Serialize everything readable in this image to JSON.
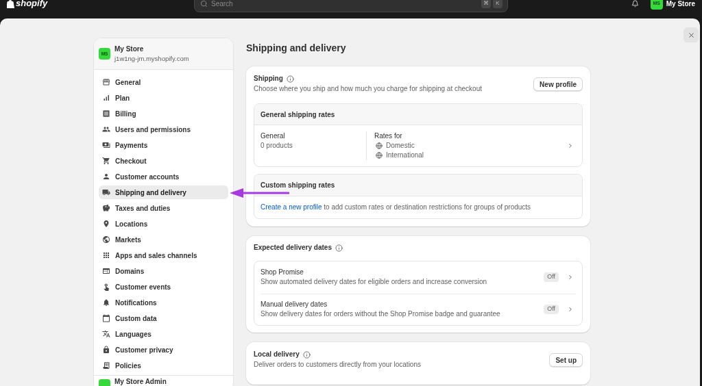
{
  "topbar": {
    "logo": "shopify",
    "search": {
      "placeholder": "Search",
      "shortcut": [
        "⌘",
        "K"
      ]
    },
    "account": {
      "initials": "MS",
      "name": "My Store"
    }
  },
  "sidebar": {
    "store": {
      "initials": "MS",
      "name": "My Store",
      "domain": "j1w1ng-jm.myshopify.com"
    },
    "items": [
      {
        "label": "General",
        "selected": false
      },
      {
        "label": "Plan",
        "selected": false
      },
      {
        "label": "Billing",
        "selected": false
      },
      {
        "label": "Users and permissions",
        "selected": false
      },
      {
        "label": "Payments",
        "selected": false
      },
      {
        "label": "Checkout",
        "selected": false
      },
      {
        "label": "Customer accounts",
        "selected": false
      },
      {
        "label": "Shipping and delivery",
        "selected": true
      },
      {
        "label": "Taxes and duties",
        "selected": false
      },
      {
        "label": "Locations",
        "selected": false
      },
      {
        "label": "Markets",
        "selected": false
      },
      {
        "label": "Apps and sales channels",
        "selected": false
      },
      {
        "label": "Domains",
        "selected": false
      },
      {
        "label": "Customer events",
        "selected": false
      },
      {
        "label": "Notifications",
        "selected": false
      },
      {
        "label": "Custom data",
        "selected": false
      },
      {
        "label": "Languages",
        "selected": false
      },
      {
        "label": "Customer privacy",
        "selected": false
      },
      {
        "label": "Policies",
        "selected": false
      }
    ],
    "footer": {
      "name": "My Store Admin"
    }
  },
  "page": {
    "title": "Shipping and delivery"
  },
  "shipping": {
    "title": "Shipping",
    "description": "Choose where you ship and how much you charge for shipping at checkout",
    "button": "New profile",
    "general_rates": {
      "title": "General shipping rates",
      "profile": "General",
      "products": "0 products",
      "rates_label": "Rates for",
      "zones": [
        "Domestic",
        "International"
      ]
    },
    "custom_rates": {
      "title": "Custom shipping rates",
      "link": "Create a new profile",
      "text": "to add custom rates or destination restrictions for groups of products"
    }
  },
  "expected_delivery": {
    "title": "Expected delivery dates",
    "options": [
      {
        "name": "Shop Promise",
        "description": "Show automated delivery dates for eligible orders and increase conversion",
        "status": "Off"
      },
      {
        "name": "Manual delivery dates",
        "description": "Show delivery dates for orders without the Shop Promise badge and guarantee",
        "status": "Off"
      }
    ]
  },
  "local_delivery": {
    "title": "Local delivery",
    "description": "Deliver orders to customers directly from your locations",
    "button": "Set up"
  }
}
